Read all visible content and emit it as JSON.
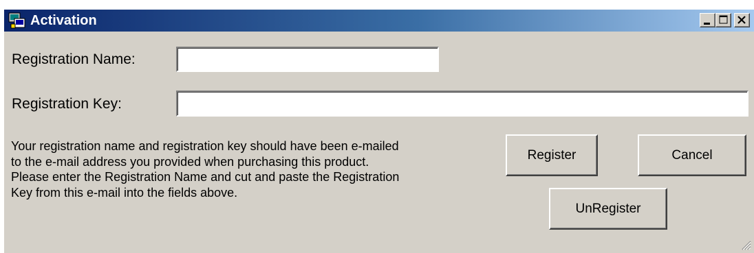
{
  "window": {
    "title": "Activation",
    "icon": "activation-app-icon",
    "controls": [
      "minimize-icon",
      "maximize-icon",
      "close-icon"
    ]
  },
  "form": {
    "name_label": "Registration Name:",
    "name_value": "",
    "key_label": "Registration Key:",
    "key_value": ""
  },
  "info_lines": [
    "Your registration name and registration key should have been e-mailed",
    "to the e-mail address you provided when purchasing this product.",
    "Please enter the Registration Name and cut and paste the Registration",
    "Key from this e-mail into the fields above."
  ],
  "buttons": {
    "register": "Register",
    "cancel": "Cancel",
    "unregister": "UnRegister"
  },
  "colors": {
    "title_gradient_start": "#0a246a",
    "title_gradient_end": "#a6caf0",
    "window_face": "#d4d0c8"
  }
}
